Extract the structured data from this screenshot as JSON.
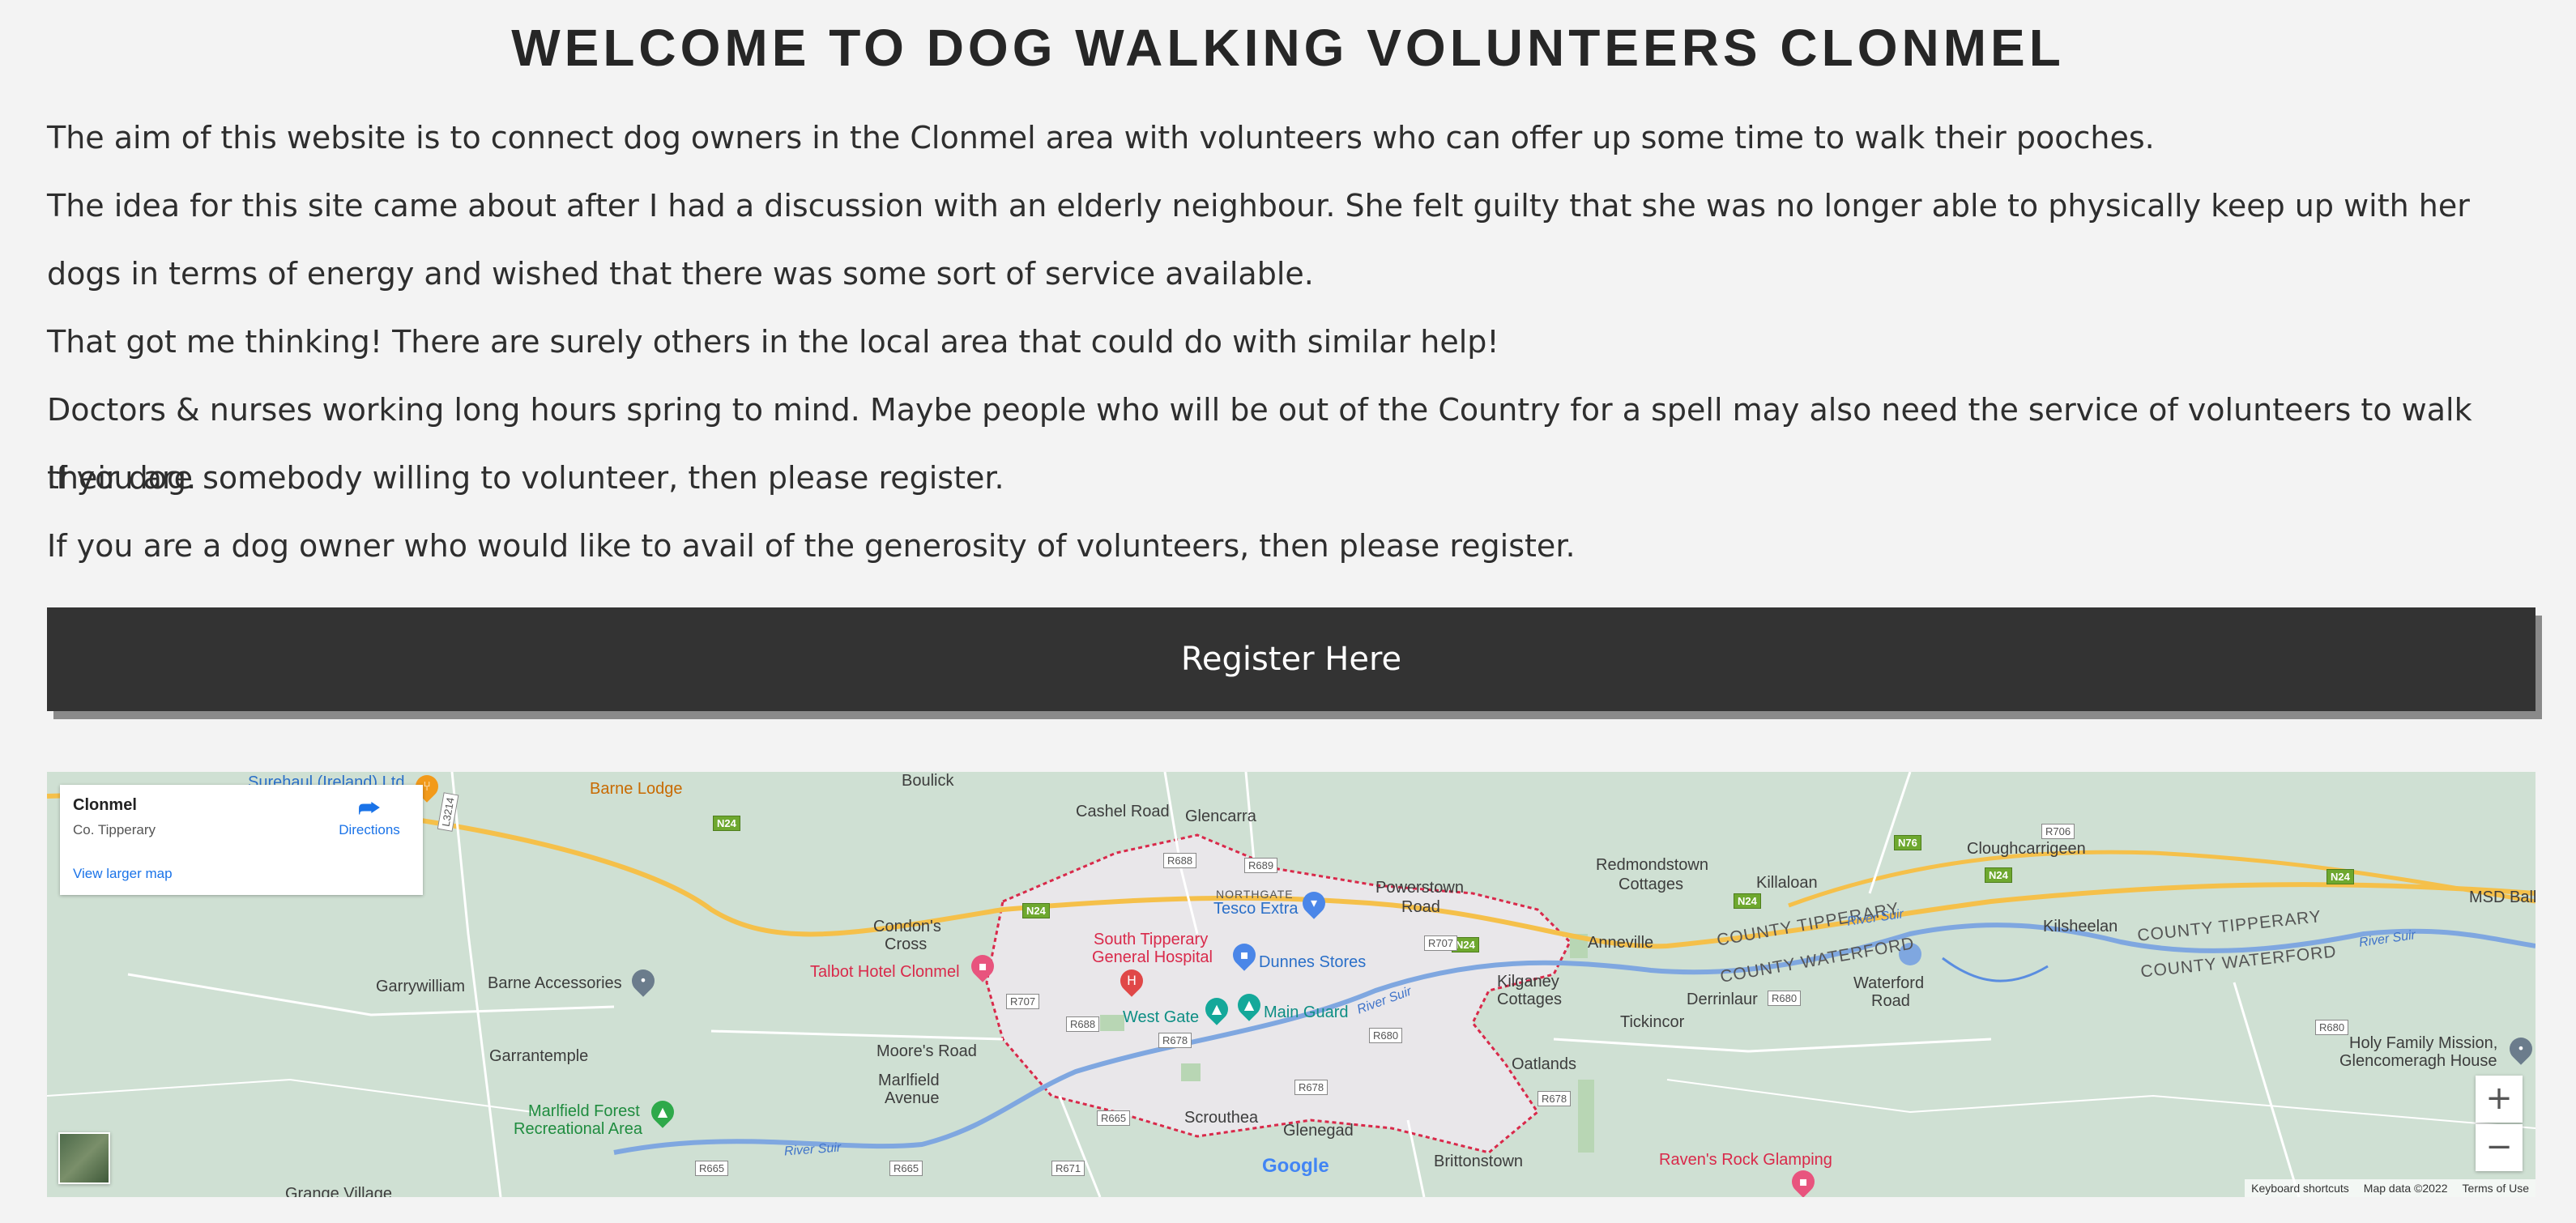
{
  "page": {
    "title": "WELCOME TO DOG WALKING VOLUNTEERS CLONMEL",
    "paragraphs": [
      "The aim of this website is to connect dog owners in the Clonmel area with volunteers who can offer up some time to walk their pooches.",
      "The idea for this site came about after I had a discussion with an elderly neighbour. She felt guilty that she was no longer able to physically keep up with her dogs in terms of energy and wished that there was some sort of service available.",
      "That got me thinking! There are surely others in the local area that could do with similar help!",
      "Doctors & nurses working long hours spring to mind. Maybe people who will be out of the Country for a spell may also need the service of volunteers to walk their dog.",
      "If you are somebody willing to volunteer, then please register.",
      "If you are a dog owner who would like to avail of the generosity of volunteers, then please register."
    ],
    "register_button": "Register Here"
  },
  "map": {
    "card": {
      "place_name": "Clonmel",
      "place_region": "Co. Tipperary",
      "larger_map_link": "View larger map",
      "directions_label": "Directions"
    },
    "labels": {
      "surehaul": "Surehaul (Ireland) Ltd",
      "barne_lodge": "Barne Lodge",
      "boulick": "Boulick",
      "cashel_road": "Cashel Road",
      "glencarra": "Glencarra",
      "northgate": "NORTHGATE",
      "tesco": "Tesco Extra",
      "powerstown_road_1": "Powerstown",
      "powerstown_road_2": "Road",
      "redmondstown_1": "Redmondstown",
      "redmondstown_2": "Cottages",
      "killaloan": "Killaloan",
      "cloughcarrigeen": "Cloughcarrigeen",
      "msd": "MSD Ball",
      "condons_1": "Condon's",
      "condons_2": "Cross",
      "hospital_1": "South Tipperary",
      "hospital_2": "General Hospital",
      "dunnes": "Dunnes Stores",
      "talbot": "Talbot Hotel Clonmel",
      "garrywilliam": "Garrywilliam",
      "barne_accessories": "Barne Accessories",
      "west_gate": "West Gate",
      "main_guard": "Main Guard",
      "kilganey_1": "Kilganey",
      "kilganey_2": "Cottages",
      "anneville": "Anneville",
      "derrinlaur": "Derrinlaur",
      "waterford_road_1": "Waterford",
      "waterford_road_2": "Road",
      "kilsheelan": "Kilsheelan",
      "county_tipperary": "COUNTY TIPPERARY",
      "county_waterford": "COUNTY WATERFORD",
      "river_suir": "River Suir",
      "garrantemple": "Garrantemple",
      "moores_road": "Moore's Road",
      "marlfield_1": "Marlfield",
      "marlfield_2": "Avenue",
      "tickincor": "Tickincor",
      "oatlands": "Oatlands",
      "holy_family_1": "Holy Family Mission,",
      "holy_family_2": "Glencomeragh House",
      "marlfield_forest_1": "Marlfield Forest",
      "marlfield_forest_2": "Recreational Area",
      "scrouthea": "Scrouthea",
      "glenegad": "Glenegad",
      "brittonstown": "Brittonstown",
      "ravens_rock": "Raven's Rock Glamping",
      "grange_village": "Grange Village",
      "google": "Google"
    },
    "roads": {
      "n24": "N24",
      "n76": "N76",
      "l3214": "L3214",
      "r688": "R688",
      "r689": "R689",
      "r707": "R707",
      "r678": "R678",
      "r680": "R680",
      "r665": "R665",
      "r671": "R671",
      "r706": "R706",
      "r707b": "R707"
    },
    "controls": {
      "zoom_in": "+",
      "zoom_out": "−"
    },
    "footer": {
      "shortcuts": "Keyboard shortcuts",
      "map_data": "Map data ©2022",
      "terms": "Terms of Use"
    },
    "colors": {
      "land": "#cfe0d3",
      "urban": "#e9e7ea",
      "river": "#7fa7e0",
      "road_major": "#f5c04a",
      "boundary": "#d9294a"
    }
  }
}
